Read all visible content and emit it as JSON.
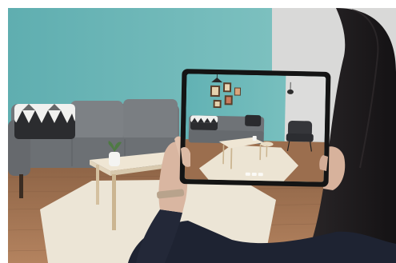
{
  "scene": {
    "kind": "photograph",
    "content_text": "",
    "colors": {
      "wall_teal": "#6fb8b9",
      "wall_right": "#dcdcdc",
      "floor_wood": "#b08060",
      "rug": "#e8e0d0",
      "sofa_gray": "#7a7d80",
      "table_wood": "#e8dcc6",
      "tablet_frame": "#1a1a1a",
      "hair_dark": "#1c1b1d",
      "jacket_navy": "#1f2433",
      "skin": "#d9b7a3"
    },
    "icons": [
      "cushion-triangle-pattern",
      "plant",
      "pendant-lamp",
      "framed-pictures",
      "armchair"
    ]
  }
}
